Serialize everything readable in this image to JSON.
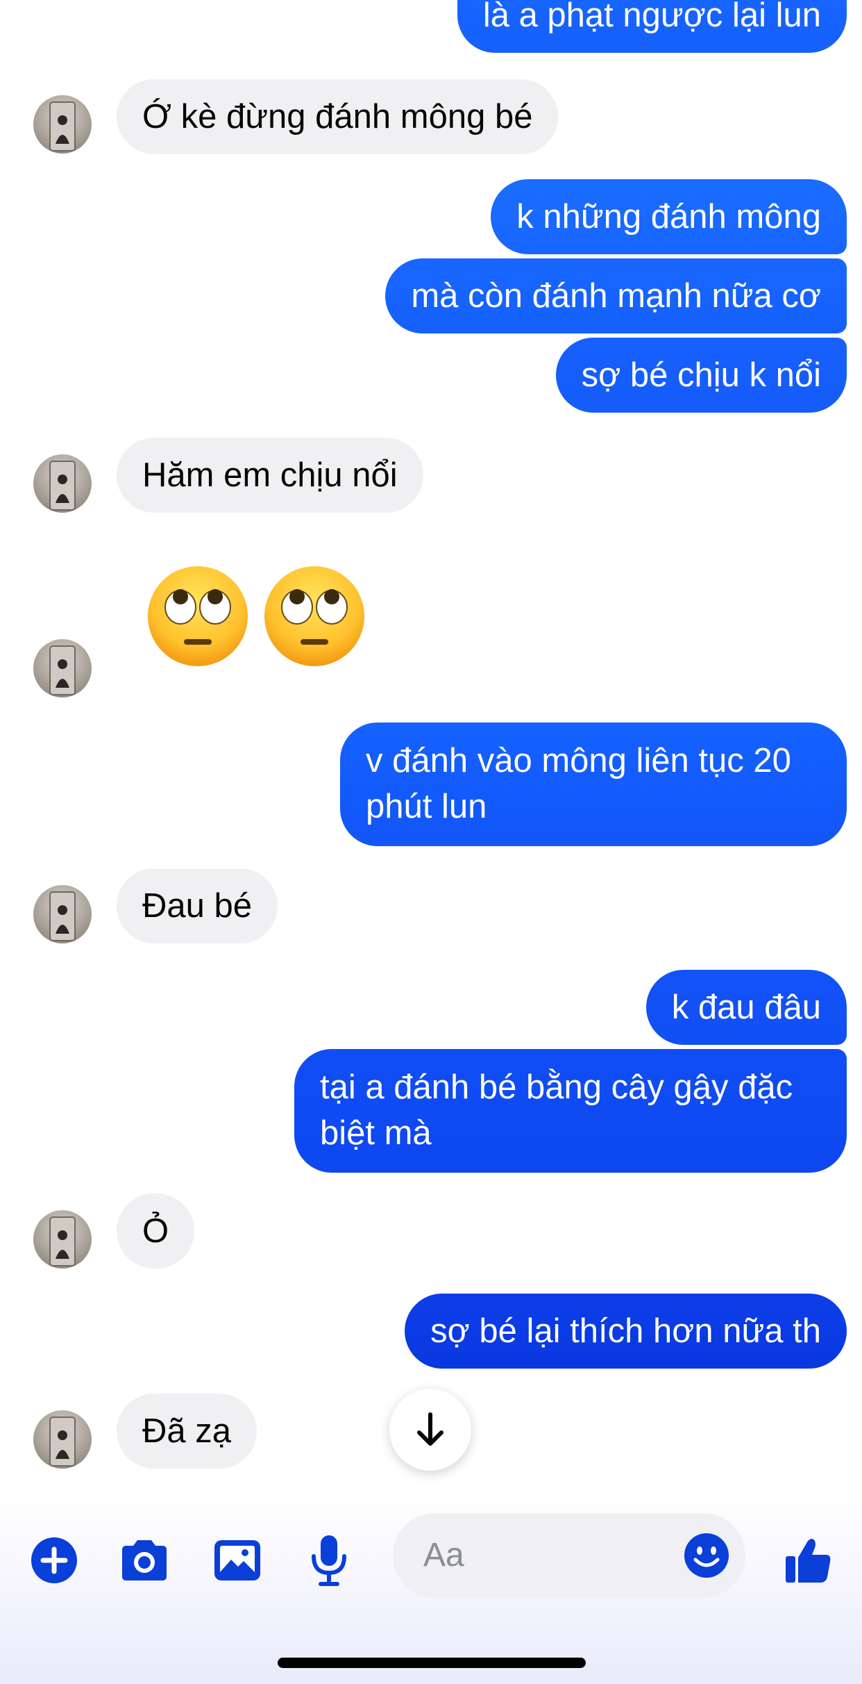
{
  "colors": {
    "accent": "#0a3fd8",
    "outgoing_top": "#1a63ff",
    "outgoing_bottom": "#0b2fd6",
    "incoming_bg": "#f0f0f2"
  },
  "messages": [
    {
      "dir": "out",
      "text": "là  a phạt ngược lại lun"
    },
    {
      "dir": "in",
      "text": "Ớ kè đừng đánh mông bé"
    },
    {
      "dir": "out",
      "text": "k những đánh mông"
    },
    {
      "dir": "out",
      "text": "mà còn đánh mạnh nữa cơ"
    },
    {
      "dir": "out",
      "text": "sợ bé chịu k nổi"
    },
    {
      "dir": "in",
      "text": "Hăm em chịu nổi"
    },
    {
      "dir": "in",
      "type": "emoji",
      "emoji": [
        "face-with-rolling-eyes",
        "face-with-rolling-eyes"
      ]
    },
    {
      "dir": "out",
      "lines": [
        "v đánh vào mông liên tục 20",
        "phút lun"
      ]
    },
    {
      "dir": "in",
      "text": "Đau bé"
    },
    {
      "dir": "out",
      "text": "k đau đâu"
    },
    {
      "dir": "out",
      "lines": [
        "tại a đánh bé bằng cây gậy đặc",
        "biệt mà"
      ]
    },
    {
      "dir": "in",
      "text": "Ỏ"
    },
    {
      "dir": "out",
      "text": "sợ bé lại thích hơn nữa th"
    },
    {
      "dir": "in",
      "text": "Đã zạ"
    }
  ],
  "scroll_down_button": {
    "icon": "arrow-down-icon"
  },
  "composer": {
    "placeholder": "Aa",
    "tools": [
      "plus-circle-icon",
      "camera-icon",
      "gallery-icon",
      "microphone-icon"
    ],
    "emoji_icon": "smiley-icon",
    "send_icon": "thumbs-up-icon"
  }
}
